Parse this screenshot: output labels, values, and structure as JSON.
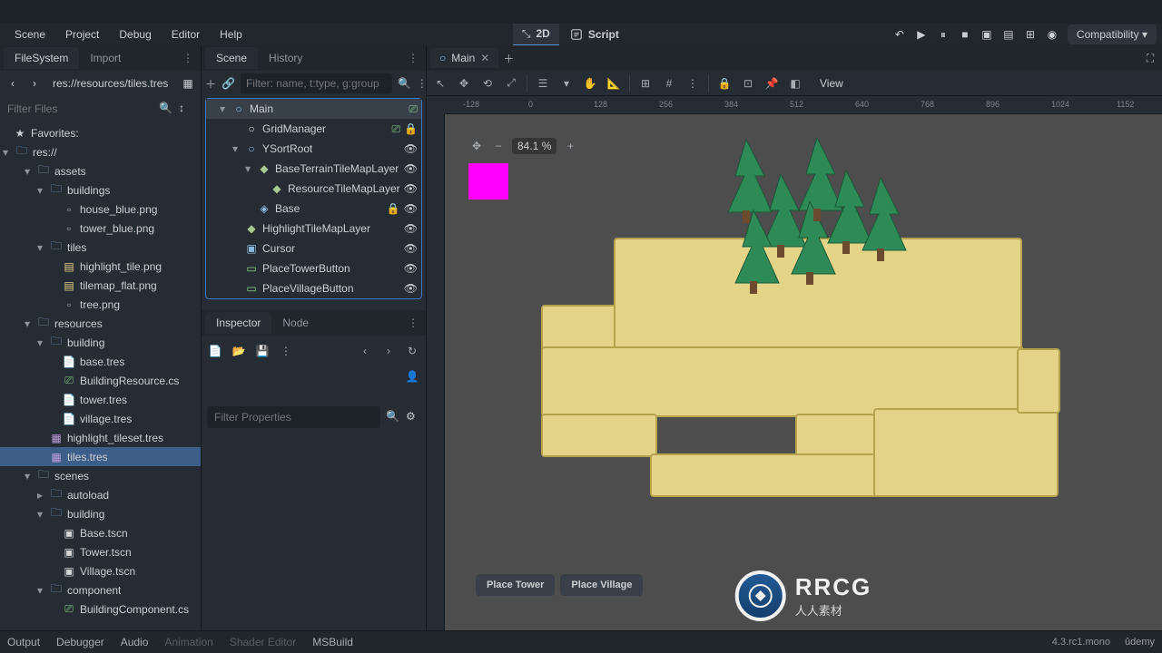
{
  "menu": {
    "scene": "Scene",
    "project": "Project",
    "debug": "Debug",
    "editor": "Editor",
    "help": "Help"
  },
  "center": {
    "twod": "2D",
    "script": "Script"
  },
  "compat": "Compatibility",
  "filesystem": {
    "title": "FileSystem",
    "import": "Import",
    "path": "res://resources/tiles.tres",
    "filter_placeholder": "Filter Files",
    "favorites": "Favorites:",
    "root": "res://",
    "tree": [
      {
        "label": "assets",
        "type": "folder",
        "depth": 1,
        "open": true
      },
      {
        "label": "buildings",
        "type": "folder",
        "depth": 2,
        "open": true
      },
      {
        "label": "house_blue.png",
        "type": "img",
        "depth": 3
      },
      {
        "label": "tower_blue.png",
        "type": "img",
        "depth": 3
      },
      {
        "label": "tiles",
        "type": "folder",
        "depth": 2,
        "open": true
      },
      {
        "label": "highlight_tile.png",
        "type": "tile",
        "depth": 3
      },
      {
        "label": "tilemap_flat.png",
        "type": "tile",
        "depth": 3
      },
      {
        "label": "tree.png",
        "type": "img",
        "depth": 3
      },
      {
        "label": "resources",
        "type": "folder",
        "depth": 1,
        "open": true
      },
      {
        "label": "building",
        "type": "folder",
        "depth": 2,
        "open": true
      },
      {
        "label": "base.tres",
        "type": "res",
        "depth": 3
      },
      {
        "label": "BuildingResource.cs",
        "type": "cs",
        "depth": 3
      },
      {
        "label": "tower.tres",
        "type": "res",
        "depth": 3
      },
      {
        "label": "village.tres",
        "type": "res",
        "depth": 3
      },
      {
        "label": "highlight_tileset.tres",
        "type": "tileset",
        "depth": 2
      },
      {
        "label": "tiles.tres",
        "type": "tileset",
        "depth": 2,
        "selected": true
      },
      {
        "label": "scenes",
        "type": "folder",
        "depth": 1,
        "open": true
      },
      {
        "label": "autoload",
        "type": "folder",
        "depth": 2
      },
      {
        "label": "building",
        "type": "folder",
        "depth": 2,
        "open": true
      },
      {
        "label": "Base.tscn",
        "type": "scene",
        "depth": 3
      },
      {
        "label": "Tower.tscn",
        "type": "scene",
        "depth": 3
      },
      {
        "label": "Village.tscn",
        "type": "scene",
        "depth": 3
      },
      {
        "label": "component",
        "type": "folder",
        "depth": 2,
        "open": true
      },
      {
        "label": "BuildingComponent.cs",
        "type": "cs",
        "depth": 3
      }
    ]
  },
  "scene": {
    "tab": "Scene",
    "history": "History",
    "filter_placeholder": "Filter: name, t:type, g:group",
    "nodes": [
      {
        "label": "Main",
        "depth": 0,
        "open": true,
        "active": true,
        "icon": "node2d",
        "script": true
      },
      {
        "label": "GridManager",
        "depth": 1,
        "icon": "node",
        "script": true,
        "lock": true
      },
      {
        "label": "YSortRoot",
        "depth": 1,
        "open": true,
        "icon": "node2d",
        "vis": true
      },
      {
        "label": "BaseTerrainTileMapLayer",
        "depth": 2,
        "open": true,
        "icon": "tml",
        "vis": true
      },
      {
        "label": "ResourceTileMapLayer",
        "depth": 3,
        "icon": "tml",
        "vis": true
      },
      {
        "label": "Base",
        "depth": 2,
        "icon": "inst",
        "vis": true,
        "lock": true
      },
      {
        "label": "HighlightTileMapLayer",
        "depth": 1,
        "icon": "tml",
        "vis": true
      },
      {
        "label": "Cursor",
        "depth": 1,
        "icon": "sprite",
        "vis": true
      },
      {
        "label": "PlaceTowerButton",
        "depth": 1,
        "icon": "btn",
        "vis": true
      },
      {
        "label": "PlaceVillageButton",
        "depth": 1,
        "icon": "btn",
        "vis": true
      }
    ]
  },
  "inspector": {
    "tab": "Inspector",
    "node": "Node",
    "filter_placeholder": "Filter Properties"
  },
  "viewport": {
    "main_tab": "Main",
    "zoom": "84.1 %",
    "view": "View",
    "place_tower": "Place Tower",
    "place_village": "Place Village",
    "ruler_ticks": [
      "-128",
      "0",
      "128",
      "256",
      "384",
      "512",
      "640",
      "768",
      "896",
      "1024",
      "1152"
    ]
  },
  "bottom": {
    "output": "Output",
    "debugger": "Debugger",
    "audio": "Audio",
    "animation": "Animation",
    "shader": "Shader Editor",
    "msbuild": "MSBuild",
    "version": "4.3.rc1.mono",
    "udemy": "ûdemy"
  },
  "watermark": {
    "big": "RRCG",
    "sub": "人人素材"
  }
}
